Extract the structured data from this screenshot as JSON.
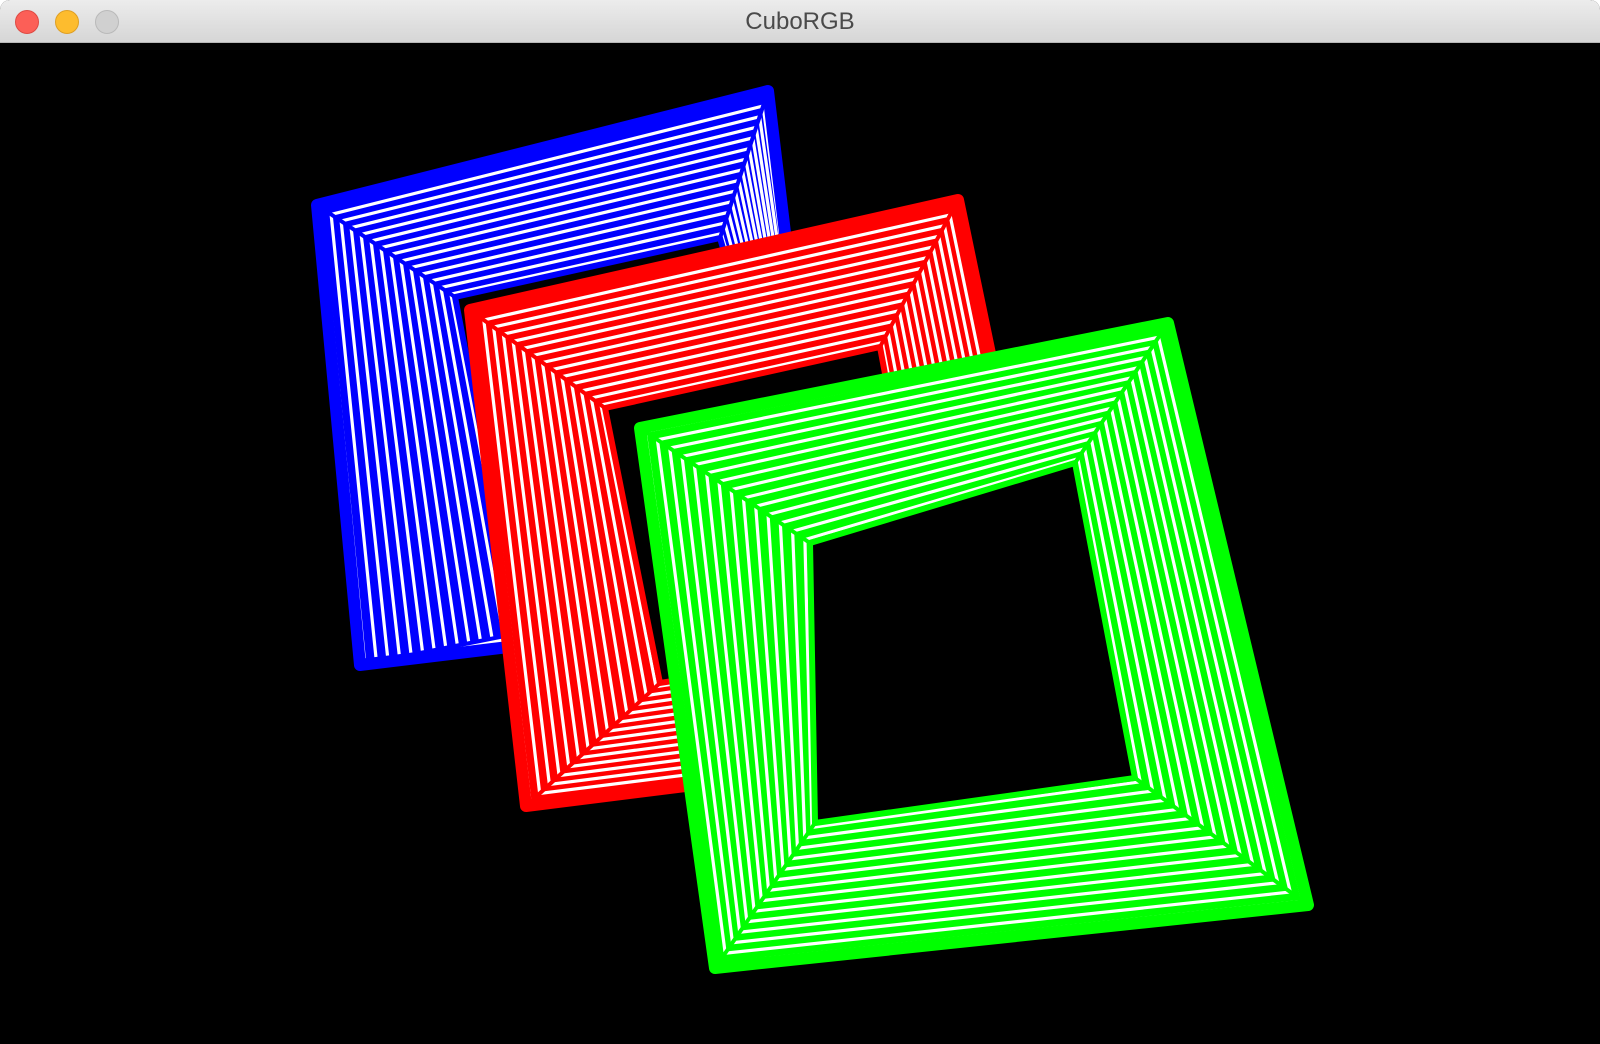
{
  "window": {
    "title": "CuboRGB"
  },
  "titlebar_buttons": {
    "close": "close-icon",
    "minimize": "minimize-icon",
    "zoom": "zoom-icon"
  },
  "scene": {
    "background": "#000000",
    "stripe_color": "#ffffff",
    "stripe_count": 14,
    "faces": [
      {
        "name": "blue",
        "color": "#0000ff"
      },
      {
        "name": "red",
        "color": "#ff0000"
      },
      {
        "name": "green",
        "color": "#00ff00"
      }
    ]
  }
}
